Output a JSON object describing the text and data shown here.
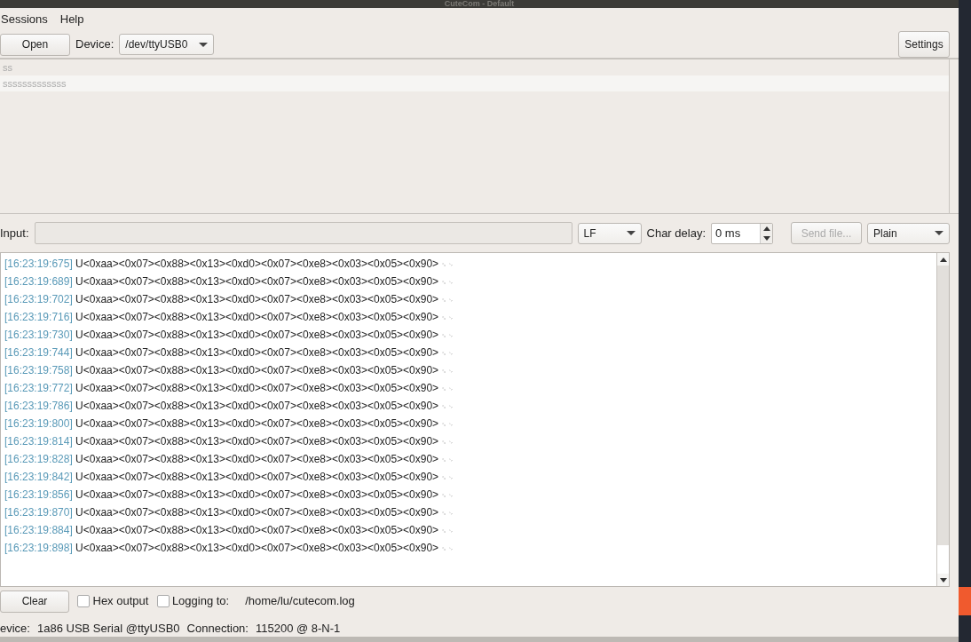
{
  "window": {
    "title": "CuteCom - Default"
  },
  "menu": [
    "Sessions",
    "Help"
  ],
  "toolbar": {
    "open_button": "Open",
    "device_label": "Device:",
    "device_value": "/dev/ttyUSB0",
    "settings_button": "Settings"
  },
  "history": [
    {
      "text": "ss",
      "selected": false
    },
    {
      "text": "sssssssssssss",
      "selected": true
    }
  ],
  "input_row": {
    "label": "Input:",
    "line_end": "LF",
    "char_delay_label": "Char delay:",
    "char_delay_value": "0 ms",
    "send_file_button": "Send file...",
    "send_file_disabled": true,
    "mode": "Plain"
  },
  "output": [
    {
      "time": "[16:23:19:675]",
      "data": "U<0xaa><0x07><0x88><0x13><0xd0><0x07><0xe8><0x03><0x05><0x90>",
      "eol": "␍ ␊"
    },
    {
      "time": "[16:23:19:689]",
      "data": "U<0xaa><0x07><0x88><0x13><0xd0><0x07><0xe8><0x03><0x05><0x90>",
      "eol": "␍ ␊"
    },
    {
      "time": "[16:23:19:702]",
      "data": "U<0xaa><0x07><0x88><0x13><0xd0><0x07><0xe8><0x03><0x05><0x90>",
      "eol": "␍ ␊"
    },
    {
      "time": "[16:23:19:716]",
      "data": "U<0xaa><0x07><0x88><0x13><0xd0><0x07><0xe8><0x03><0x05><0x90>",
      "eol": "␍ ␊"
    },
    {
      "time": "[16:23:19:730]",
      "data": "U<0xaa><0x07><0x88><0x13><0xd0><0x07><0xe8><0x03><0x05><0x90>",
      "eol": "␍ ␊"
    },
    {
      "time": "[16:23:19:744]",
      "data": "U<0xaa><0x07><0x88><0x13><0xd0><0x07><0xe8><0x03><0x05><0x90>",
      "eol": "␍ ␊"
    },
    {
      "time": "[16:23:19:758]",
      "data": "U<0xaa><0x07><0x88><0x13><0xd0><0x07><0xe8><0x03><0x05><0x90>",
      "eol": "␍ ␊"
    },
    {
      "time": "[16:23:19:772]",
      "data": "U<0xaa><0x07><0x88><0x13><0xd0><0x07><0xe8><0x03><0x05><0x90>",
      "eol": "␍ ␊"
    },
    {
      "time": "[16:23:19:786]",
      "data": "U<0xaa><0x07><0x88><0x13><0xd0><0x07><0xe8><0x03><0x05><0x90>",
      "eol": "␍ ␊"
    },
    {
      "time": "[16:23:19:800]",
      "data": "U<0xaa><0x07><0x88><0x13><0xd0><0x07><0xe8><0x03><0x05><0x90>",
      "eol": "␍ ␊"
    },
    {
      "time": "[16:23:19:814]",
      "data": "U<0xaa><0x07><0x88><0x13><0xd0><0x07><0xe8><0x03><0x05><0x90>",
      "eol": "␍ ␊"
    },
    {
      "time": "[16:23:19:828]",
      "data": "U<0xaa><0x07><0x88><0x13><0xd0><0x07><0xe8><0x03><0x05><0x90>",
      "eol": "␍ ␊"
    },
    {
      "time": "[16:23:19:842]",
      "data": "U<0xaa><0x07><0x88><0x13><0xd0><0x07><0xe8><0x03><0x05><0x90>",
      "eol": "␍ ␊"
    },
    {
      "time": "[16:23:19:856]",
      "data": "U<0xaa><0x07><0x88><0x13><0xd0><0x07><0xe8><0x03><0x05><0x90>",
      "eol": "␍ ␊"
    },
    {
      "time": "[16:23:19:870]",
      "data": "U<0xaa><0x07><0x88><0x13><0xd0><0x07><0xe8><0x03><0x05><0x90>",
      "eol": "␍ ␊"
    },
    {
      "time": "[16:23:19:884]",
      "data": "U<0xaa><0x07><0x88><0x13><0xd0><0x07><0xe8><0x03><0x05><0x90>",
      "eol": "␍ ␊"
    },
    {
      "time": "[16:23:19:898]",
      "data": "U<0xaa><0x07><0x88><0x13><0xd0><0x07><0xe8><0x03><0x05><0x90>",
      "eol": "␍ ␊"
    }
  ],
  "bottom_bar": {
    "clear_button": "Clear",
    "hex_output": {
      "label": "Hex output",
      "checked": false
    },
    "logging": {
      "label": "Logging to:",
      "checked": false
    },
    "log_path": "/home/lu/cutecom.log"
  },
  "status_bar": {
    "device_label": "evice:",
    "device_value": "1a86 USB Serial @ttyUSB0",
    "connection_label": "Connection:",
    "connection_value": "115200 @ 8-N-1"
  }
}
